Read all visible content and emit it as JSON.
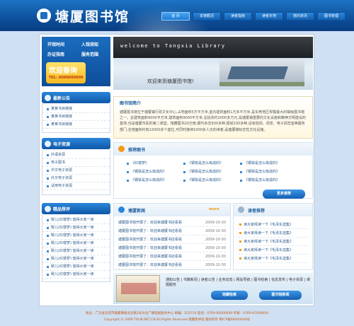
{
  "header": {
    "title": "塘厦图书馆",
    "nav": [
      {
        "label": "首  页",
        "active": true
      },
      {
        "label": "本馆概况",
        "active": false
      },
      {
        "label": "读者指南",
        "active": false
      },
      {
        "label": "读者天地",
        "active": false
      },
      {
        "label": "馆内资讯",
        "active": false
      },
      {
        "label": "图书管理",
        "active": false
      }
    ]
  },
  "sidebar": {
    "login": {
      "hours": "开馆时间",
      "register": "入馆须知",
      "guide": "办证指南",
      "service": "服务范围"
    },
    "hotline": {
      "title": "欢迎垂询",
      "tel": "TEL: 0000000000"
    },
    "notice": {
      "title": "最新公告",
      "items": [
        "某某书目链接",
        "某某书目链接",
        "某某书目链接"
      ]
    },
    "eresource": {
      "title": "电子资源",
      "items": [
        "外语资源",
        "电子图书",
        "中文电子资源",
        "外文电子资源",
        "试用电子资源"
      ]
    },
    "recommend": {
      "title": "精品荐评",
      "items": [
        "致儿(红楼梦) 值得大家一读",
        "致儿(红楼梦) 值得大家一读",
        "致儿(红楼梦) 值得大家一读",
        "致儿(红楼梦) 值得大家一读",
        "致儿(红楼梦) 值得大家一读",
        "致儿(红楼梦) 值得大家一读",
        "致儿(红楼梦) 值得大家一读",
        "致儿(红楼梦) 值得大家一读"
      ]
    }
  },
  "banner": {
    "welcome_en": "welcome to Tangxia Library",
    "welcome_cn": "欢迎来到塘厦图书馆!"
  },
  "intro": {
    "title": "图书馆简介",
    "text": "塘厦图书馆位于塘厦镇行政文化中心,占地面积5万平方米,室内建筑面积1万多平方米,是东莞地区规模最大的镇级图书馆之一。总建筑面积9000平方米,建筑面积9000平方米,总投资约2000多万元,是塘厦镇重要的文化设施和精神文明建设的基地,也是塘厦市民的第二课堂。馆藏图书20万册,期刊杂志600多种,报纸100多种,设有借阅、阅览、电子阅览室等服务部门,全馆面积约有12000多个座位,可同时接待1000多人次的读者,是塘厦镇标志性文化设施。"
  },
  "recommend_books": {
    "title": "推荐图书",
    "items": [
      "《红楼梦》",
      "《钢铁是怎么炼成的》",
      "《钢铁是怎么炼成的》",
      "《钢铁是怎么炼成的》",
      "《钢铁是怎么炼成的》",
      "《钢铁是怎么炼成的》",
      "《钢铁是怎么炼成的》",
      "《钢铁是怎么炼成的》",
      "《钢铁是怎么炼成的》"
    ],
    "more": "更多推荐"
  },
  "news": {
    "title": "塘厦新闻",
    "more": "more",
    "rows": [
      {
        "text": "塘厦图书馆开展了：欢迎来塘厦书店看看",
        "date": "2009-10-30"
      },
      {
        "text": "塘厦图书馆开展了：欢迎来塘厦书店看看",
        "date": "2009-10-30"
      },
      {
        "text": "塘厦图书馆开展了：欢迎来塘厦书店看看",
        "date": "2009-10-30"
      },
      {
        "text": "塘厦图书馆开展了：欢迎来塘厦书店看看",
        "date": "2009-10-30"
      },
      {
        "text": "塘厦图书馆开展了：欢迎来塘厦书店看看",
        "date": "2009-10-30"
      },
      {
        "text": "塘厦图书馆开展了：欢迎来塘厦书店看看",
        "date": "2009-10-30"
      }
    ]
  },
  "reader": {
    "title": "读者推荐",
    "rows": [
      "读大家拜读一下《毛泽东选集》",
      "读大家拜读一下《毛泽东选集》",
      "读大家拜读一下《毛泽东选集》",
      "读大家拜读一下《毛泽东选集》",
      "读大家拜读一下《毛泽东选集》"
    ]
  },
  "bottom": {
    "links": "通知公告 | 书籍新闻 | 读者公告 | 业务动态 | 网站导航 | 图书检索 | 信息发布 | 电子资源 | 课题服务",
    "btn_service": "馆藏检索",
    "btn_book": "图书馆新闻"
  },
  "footer": {
    "line1": "地址：广东省东莞市塘厦镇塘龙东路3号文化广播电视服务中心 邮编：523710 电话：0769-00000000 传真：0769-87000000",
    "line2": "Copyright © 2009 TXLIB.NET.CN  All Rights Reserved 塘厦图书馆 版权所有  粤ICP备09000000号"
  },
  "colors": {
    "brand": "#0b4a95",
    "accent": "#f6b81f"
  }
}
